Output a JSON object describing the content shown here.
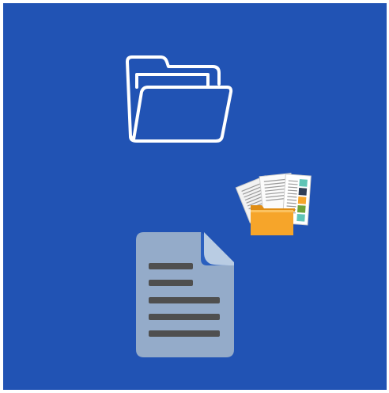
{
  "icons": {
    "top": "folder-open-outline-icon",
    "middle": "papers-in-folder-icon",
    "bottom": "text-document-icon"
  },
  "colors": {
    "background": "#2153b4",
    "border": "#ffffff",
    "outline_icon": "#ffffff",
    "folder_orange": "#f6a52a",
    "document_body": "#94abc9",
    "document_fold": "#b9cce3",
    "document_lines": "#4f4f4f"
  }
}
